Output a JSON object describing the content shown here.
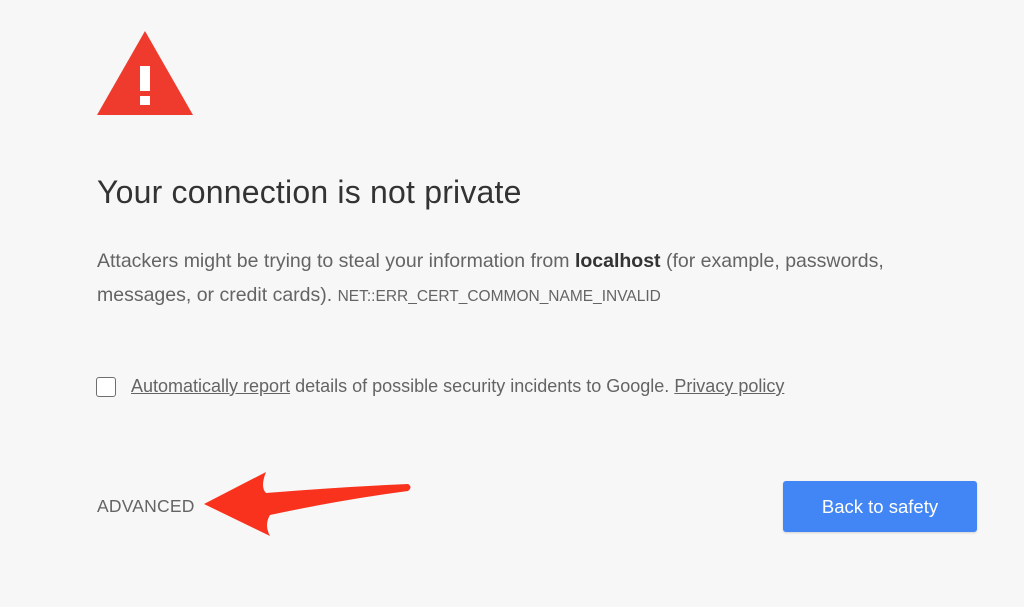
{
  "interstitial": {
    "title": "Your connection is not private",
    "description_prefix": "Attackers might be trying to steal your information from",
    "host": "localhost",
    "description_suffix": "(for example, passwords, messages, or credit cards).",
    "error_code": "NET::ERR_CERT_COMMON_NAME_INVALID",
    "report": {
      "link_label": "Automatically report",
      "text": "details of possible security incidents to Google.",
      "privacy_link": "Privacy policy",
      "checked": false
    },
    "advanced_label": "ADVANCED",
    "back_label": "Back to safety"
  },
  "colors": {
    "warning_red": "#ef3b2d",
    "primary_button": "#4285f4",
    "background": "#f7f7f7",
    "annotation_arrow": "#f9321e"
  },
  "icons": {
    "warning": "warning-triangle-icon",
    "annotation": "red-arrow-annotation"
  }
}
